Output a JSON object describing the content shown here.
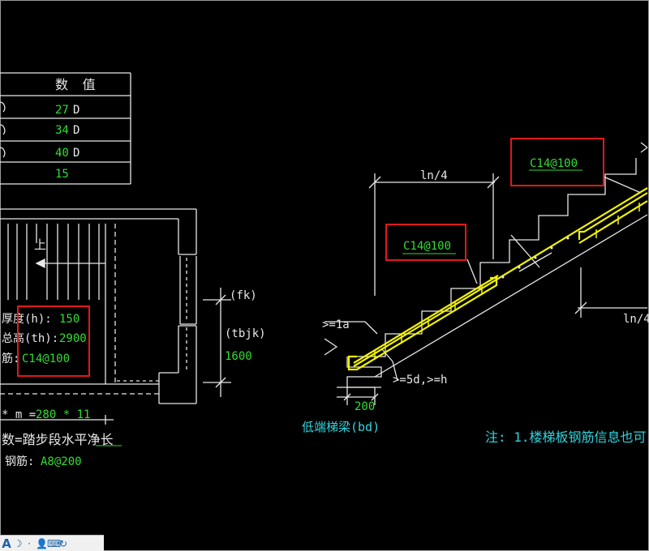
{
  "table": {
    "header_value": "数 值",
    "rows": [
      {
        "num": "27",
        "unit": "D"
      },
      {
        "num": "34",
        "unit": "D"
      },
      {
        "num": "40",
        "unit": "D"
      },
      {
        "num": "15",
        "unit": ""
      }
    ]
  },
  "plan": {
    "up_label": "上",
    "fk_label": "(fk)",
    "tbjk_label": "(tbjk)",
    "tbjk_value": "1600",
    "thickness_label": "厚度(h):",
    "thickness_value": "150",
    "height_label": "总高(th):",
    "height_value": "2900",
    "rebar_label": "筋:",
    "rebar_value": "C14@100",
    "steps_label": "* m =",
    "steps_value": "280 * 11",
    "note_label": "数=踏步段水平净长",
    "dist_label": "钢筋:",
    "dist_value": "A8@200"
  },
  "section": {
    "ln4_top": "ln/4",
    "ln4_right": "ln/4",
    "rebar_top": "C14@100",
    "rebar_mid": "C14@100",
    "la_label": ">=1a",
    "anchor_label": ">=5d,>=h",
    "width_value": "200",
    "low_beam_label": "低端梯梁(bd)",
    "note_text": "注: 1.楼梯板钢筋信息也可"
  },
  "colors": {
    "bg": "#000000",
    "line": "#e8e8e8",
    "green": "#33dd33",
    "yellow": "#f2f200",
    "cyan": "#2fd6e0",
    "highlight_red": "#e11919"
  },
  "taskbar": {
    "icons": [
      "text-style-icon",
      "moon-icon",
      "dot-icon",
      "user-icon",
      "keyboard-icon",
      "refresh-icon"
    ],
    "a_glyph": "A"
  }
}
